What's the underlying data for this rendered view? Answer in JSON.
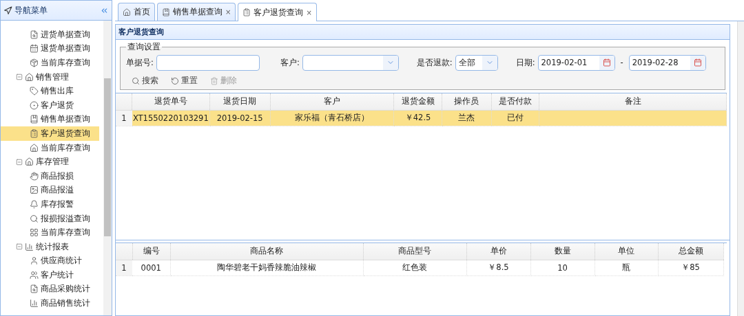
{
  "sidebar": {
    "title": "导航菜单",
    "tree": [
      {
        "kind": "continued",
        "children": [
          {
            "label": "进货单据查询",
            "selected": false
          },
          {
            "label": "退货单据查询",
            "selected": false
          },
          {
            "label": "当前库存查询",
            "selected": false
          }
        ]
      },
      {
        "kind": "group",
        "label": "销售管理",
        "expanded": true,
        "children": [
          {
            "label": "销售出库",
            "selected": false
          },
          {
            "label": "客户退货",
            "selected": false
          },
          {
            "label": "销售单据查询",
            "selected": false
          },
          {
            "label": "客户退货查询",
            "selected": true
          },
          {
            "label": "当前库存查询",
            "selected": false
          }
        ]
      },
      {
        "kind": "group",
        "label": "库存管理",
        "expanded": true,
        "children": [
          {
            "label": "商品报损",
            "selected": false
          },
          {
            "label": "商品报溢",
            "selected": false
          },
          {
            "label": "库存报警",
            "selected": false
          },
          {
            "label": "报损报溢查询",
            "selected": false
          },
          {
            "label": "当前库存查询",
            "selected": false
          }
        ]
      },
      {
        "kind": "group",
        "label": "统计报表",
        "expanded": true,
        "children": [
          {
            "label": "供应商统计",
            "selected": false
          },
          {
            "label": "客户统计",
            "selected": false
          },
          {
            "label": "商品采购统计",
            "selected": false
          },
          {
            "label": "商品销售统计",
            "selected": false
          }
        ]
      }
    ]
  },
  "tabs": [
    {
      "label": "首页",
      "closable": false,
      "selected": false
    },
    {
      "label": "销售单据查询",
      "closable": true,
      "selected": false
    },
    {
      "label": "客户退货查询",
      "closable": true,
      "selected": true
    }
  ],
  "close_glyph": "×",
  "panel": {
    "title": "客户退货查询",
    "query": {
      "legend": "查询设置",
      "fields": [
        {
          "kind": "text",
          "label": "单据号:"
        },
        {
          "kind": "combo",
          "label": "客户:"
        },
        {
          "kind": "combo",
          "label": "是否退款:",
          "value": "全部"
        },
        {
          "kind": "date",
          "label": "日期:",
          "value": "2019-02-01"
        },
        {
          "kind": "sep",
          "label": "-"
        },
        {
          "kind": "date",
          "value": "2019-02-28"
        }
      ],
      "buttons": [
        {
          "label": "搜索",
          "disabled": false
        },
        {
          "label": "重置",
          "disabled": false
        },
        {
          "label": "删除",
          "disabled": true
        }
      ]
    },
    "returns_table": {
      "columns": [
        "退货单号",
        "退货日期",
        "客户",
        "退货金额",
        "操作员",
        "是否付款",
        "备注"
      ],
      "rows": [
        {
          "index": "1",
          "selected": true,
          "cells": [
            "XT1550220103291",
            "2019-02-15",
            "家乐福（青石桥店）",
            "￥42.5",
            "兰杰",
            "已付",
            null
          ]
        }
      ]
    },
    "items_table": {
      "columns": [
        "编号",
        "商品名称",
        "商品型号",
        "单价",
        "数量",
        "单位",
        "总金额"
      ],
      "rows": [
        {
          "index": "1",
          "selected": false,
          "cells": [
            "0001",
            "陶华碧老干妈香辣脆油辣椒",
            "红色装",
            "￥8.5",
            "10",
            "瓶",
            "￥85"
          ]
        }
      ]
    }
  }
}
